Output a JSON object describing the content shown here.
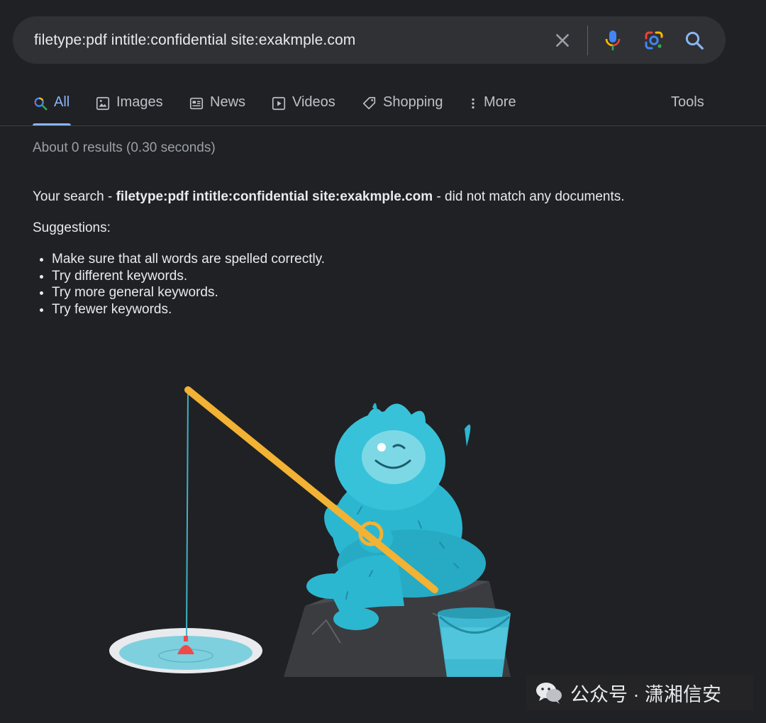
{
  "search": {
    "query": "filetype:pdf intitle:confidential site:exakmple.com"
  },
  "tabs": [
    {
      "label": "All",
      "icon": "search-icon",
      "active": true
    },
    {
      "label": "Images",
      "icon": "image-icon"
    },
    {
      "label": "News",
      "icon": "news-icon"
    },
    {
      "label": "Videos",
      "icon": "video-icon"
    },
    {
      "label": "Shopping",
      "icon": "tag-icon"
    },
    {
      "label": "More",
      "icon": "more-vert-icon"
    }
  ],
  "tools_label": "Tools",
  "result_stats": "About 0 results (0.30 seconds)",
  "no_match": {
    "prefix": "Your search - ",
    "query": "filetype:pdf intitle:confidential site:exakmple.com",
    "suffix": " - did not match any documents."
  },
  "suggestions": {
    "title": "Suggestions:",
    "items": [
      "Make sure that all words are spelled correctly.",
      "Try different keywords.",
      "Try more general keywords.",
      "Try fewer keywords."
    ]
  },
  "watermark": {
    "text": "公众号 · 潇湘信安",
    "icon": "wechat-icon"
  },
  "colors": {
    "background": "#202124",
    "searchbar": "#303134",
    "accent": "#8ab4f8",
    "muted": "#9aa0a6"
  }
}
